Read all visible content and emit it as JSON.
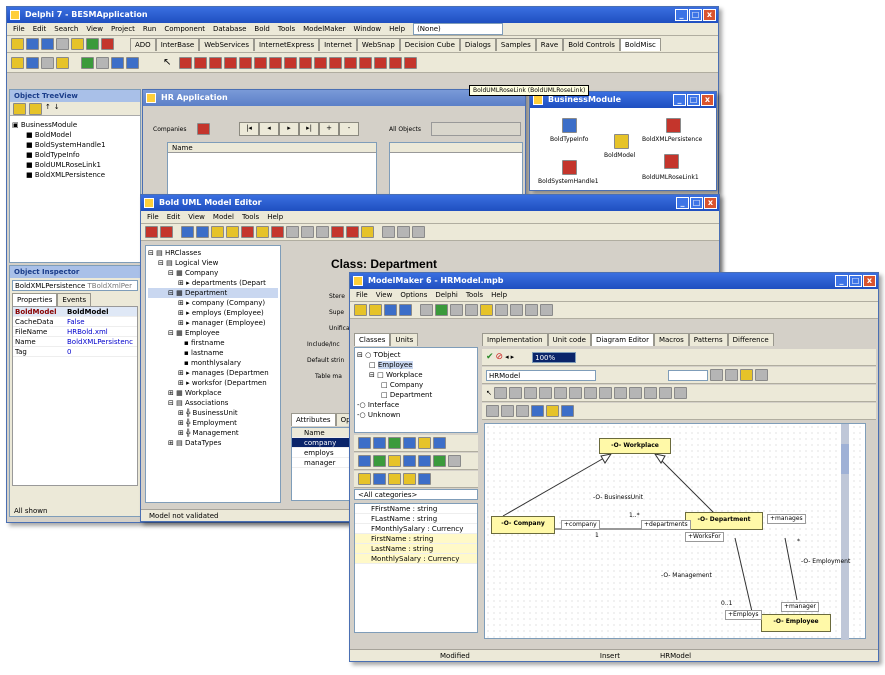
{
  "ide": {
    "title": "Delphi 7 - BESMApplication",
    "menu": [
      "File",
      "Edit",
      "Search",
      "View",
      "Project",
      "Run",
      "Component",
      "Database",
      "Bold",
      "Tools",
      "ModelMaker",
      "Window",
      "Help"
    ],
    "desktop_combo": "(None)",
    "palette_tabs": [
      "ADO",
      "InterBase",
      "WebServices",
      "InternetExpress",
      "Internet",
      "WebSnap",
      "Decision Cube",
      "Dialogs",
      "Samples",
      "Rave",
      "Bold Controls",
      "BoldMisc"
    ],
    "tooltip": "BoldUMLRoseLink (BoldUMLRoseLink)"
  },
  "treeview": {
    "title": "Object TreeView",
    "items": [
      "BusinessModule",
      "BoldModel",
      "BoldSystemHandle1",
      "BoldTypeInfo",
      "BoldUMLRoseLink1",
      "BoldXMLPersistence"
    ]
  },
  "inspector": {
    "title": "Object Inspector",
    "selected": "BoldXMLPersistence",
    "selected_type": "TBoldXmlPer",
    "tabs": [
      "Properties",
      "Events"
    ],
    "props": [
      [
        "BoldModel",
        "BoldModel"
      ],
      [
        "CacheData",
        "False"
      ],
      [
        "FileName",
        "HRBold.xml"
      ],
      [
        "Name",
        "BoldXMLPersistenc"
      ],
      [
        "Tag",
        "0"
      ]
    ],
    "status": "All shown"
  },
  "hrapp": {
    "title": "HR Application",
    "companies_label": "Companies",
    "all_objects_label": "All Objects",
    "name_col": "Name"
  },
  "busmodule": {
    "title": "BusinessModule",
    "components": [
      "BoldTypeInfo",
      "BoldModel",
      "BoldXMLPersistence",
      "BoldSystemHandle1",
      "BoldUMLRoseLink1"
    ]
  },
  "umleditor": {
    "title": "Bold UML Model Editor",
    "menu": [
      "File",
      "Edit",
      "View",
      "Model",
      "Tools",
      "Help"
    ],
    "tree": [
      "HRClasses",
      "Logical View",
      "Company",
      "departments (Depart",
      "Department",
      "company (Company)",
      "employs (Employee)",
      "manager (Employee)",
      "Employee",
      "firstname",
      "lastname",
      "monthlysalary",
      "manages (Departmen",
      "worksfor (Departmen",
      "Workplace",
      "Associations",
      "BusinessUnit",
      "Employment",
      "Management",
      "DataTypes"
    ],
    "class_title": "Class: Department",
    "field_labels": [
      "Stere",
      "Supe",
      "Unifica",
      "Include/Inc",
      "Default strin",
      "Table ma"
    ],
    "tabs": [
      "Attributes",
      "Operations"
    ],
    "attrs": [
      "Name",
      "company",
      "employs",
      "manager"
    ],
    "status": "Model not validated"
  },
  "modelmaker": {
    "title": "ModelMaker 6 - HRModel.mpb",
    "menu": [
      "File",
      "View",
      "Options",
      "Delphi",
      "Tools",
      "Help"
    ],
    "left_tabs": [
      "Classes",
      "Units"
    ],
    "right_tabs": [
      "Implementation",
      "Unit code",
      "Diagram Editor",
      "Macros",
      "Patterns",
      "Difference"
    ],
    "classes": [
      "TObject",
      "Employee",
      "Workplace",
      "Company",
      "Department",
      "Interface",
      "Unknown"
    ],
    "zoom": "100%",
    "diagram_combo": "HRModel",
    "categories": "<All categories>",
    "members": [
      "FFirstName : string",
      "FLastName : string",
      "FMonthlySalary : Currency",
      "FirstName : string",
      "LastName : string",
      "MonthlySalary : Currency"
    ],
    "diagram": {
      "workplace": "-O- Workplace",
      "company": "-O- Company",
      "department": "-O- Department",
      "employee": "-O- Employee",
      "business_unit": "-O- BusinessUnit",
      "employment": "-O- Employment",
      "management": "-O- Management",
      "company_role": "+company",
      "departments_role": "+departments",
      "worksfor_role": "+WorksFor",
      "manages_role": "+manages",
      "manager_role": "+manager",
      "employs_role": "+Employs",
      "mult_one": "1",
      "mult_many": "1..*",
      "mult_zero_one": "0..1",
      "mult_star": "*"
    },
    "status": [
      "Modified",
      "Insert",
      "HRModel"
    ]
  }
}
